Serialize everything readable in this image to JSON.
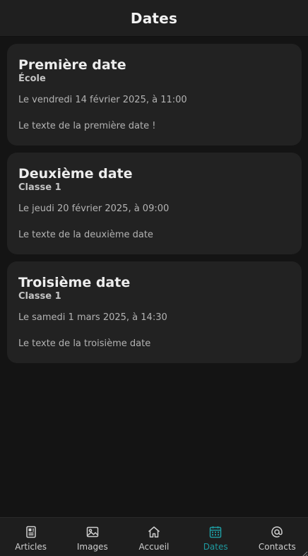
{
  "header": {
    "title": "Dates"
  },
  "cards": [
    {
      "title": "Première date",
      "subtitle": "École",
      "date": "Le vendredi 14 février 2025, à 11:00",
      "text": "Le texte de la première date !"
    },
    {
      "title": "Deuxième date",
      "subtitle": "Classe 1",
      "date": "Le jeudi 20 février 2025, à 09:00",
      "text": "Le texte de la deuxième date"
    },
    {
      "title": "Troisième date",
      "subtitle": "Classe 1",
      "date": "Le samedi 1 mars 2025, à 14:30",
      "text": "Le texte de la troisième date"
    }
  ],
  "tabbar": {
    "active_color": "#1e9aa0",
    "items": [
      {
        "label": "Articles",
        "icon": "newspaper-icon"
      },
      {
        "label": "Images",
        "icon": "image-icon"
      },
      {
        "label": "Accueil",
        "icon": "home-icon"
      },
      {
        "label": "Dates",
        "icon": "calendar-icon",
        "active": true
      },
      {
        "label": "Contacts",
        "icon": "at-icon"
      }
    ]
  }
}
